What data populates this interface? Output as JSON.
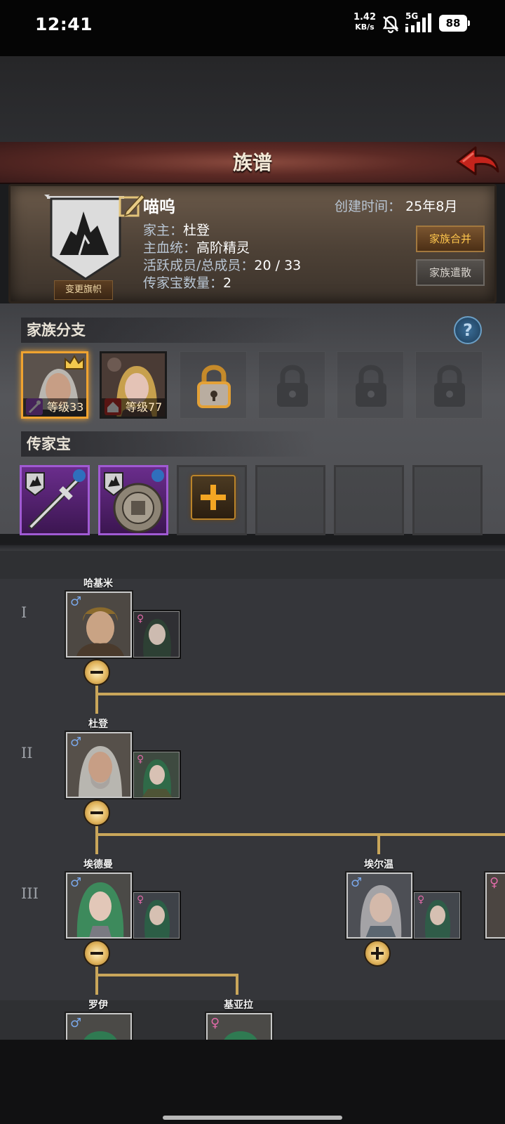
{
  "status_bar": {
    "time": "12:41",
    "net_speed": "1.42",
    "net_unit": "KB/s",
    "signal_label": "5G",
    "battery": "88"
  },
  "header": {
    "title": "族谱"
  },
  "family": {
    "name": "喵呜",
    "created_label": "创建时间：",
    "created_value": "25年8月",
    "patriarch_label": "家主：",
    "patriarch_value": "杜登",
    "bloodline_label": "主血统：",
    "bloodline_value": "高阶精灵",
    "members_label": "活跃成员/总成员：",
    "members_value": "20 / 33",
    "heirloom_count_label": "传家宝数量：",
    "heirloom_count_value": "2",
    "change_banner_label": "变更旗帜",
    "merge_label": "家族合并",
    "disband_label": "家族遣散"
  },
  "branches": {
    "title": "家族分支",
    "help": "?",
    "items": [
      {
        "level": "等级33"
      },
      {
        "level": "等级77"
      }
    ]
  },
  "heirlooms": {
    "title": "传家宝"
  },
  "tree": {
    "generations": [
      "I",
      "II",
      "III"
    ],
    "members": {
      "hakimi": "哈基米",
      "duden": "杜登",
      "edeman": "埃德曼",
      "erwen": "埃尔温",
      "luoyi": "罗伊",
      "jiyala": "基亚拉"
    },
    "male_symbol": "♂",
    "female_symbol": "♀"
  },
  "colors": {
    "accent_gold": "#c9a65a",
    "header_red": "#7a3a32",
    "heirloom_purple": "#a05ad3",
    "male_blue": "#7aa7e8",
    "female_pink": "#e06aa8"
  }
}
